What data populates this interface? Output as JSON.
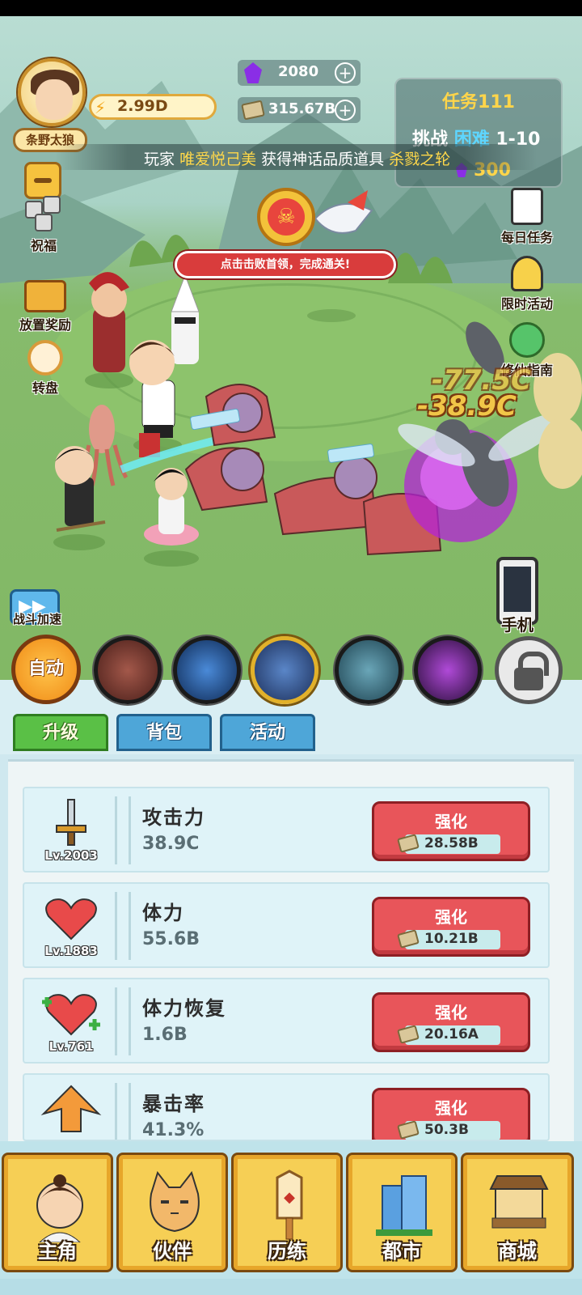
{
  "hud": {
    "player_name": "条野太狼",
    "power": "2.99D",
    "gems": "2080",
    "cash": "315.67B",
    "quest_title": "任务111",
    "quest_challenge_prefix": "挑战",
    "quest_difficulty": "困难",
    "quest_stage": "1-10",
    "quest_reward": "300",
    "ticker": {
      "prefix": "玩家",
      "player": "唯爱悦己美",
      "middle": "获得神话品质道具",
      "item": "杀戮之轮"
    },
    "boss_banner": "点击击败首领，完成通关!"
  },
  "left_menu": [
    {
      "label": "祝福",
      "icon": "dice-icon"
    },
    {
      "label": "放置奖励",
      "icon": "treasure-chest-icon"
    },
    {
      "label": "转盘",
      "icon": "wheel-icon"
    }
  ],
  "right_menu": [
    {
      "label": "每日任务",
      "icon": "daily-task-icon"
    },
    {
      "label": "限时活动",
      "icon": "party-popper-icon"
    },
    {
      "label": "修仙指南",
      "icon": "guide-icon"
    }
  ],
  "damage_numbers": [
    "-77.5C",
    "-38.9C"
  ],
  "battle_speed_label": "战斗加速",
  "phone_label": "手机",
  "auto_label": "自动",
  "skills": [
    "wolf-skill-icon",
    "blue-slash-skill-icon",
    "lightning-gate-skill-icon",
    "dragon-skill-icon",
    "purple-vortex-skill-icon",
    "lock-icon"
  ],
  "tabs": [
    "升级",
    "背包",
    "活动"
  ],
  "upgrades": [
    {
      "name": "攻击力",
      "value": "38.9C",
      "level": "Lv.2003",
      "button": "强化",
      "cost": "28.58B",
      "icon": "sword-icon"
    },
    {
      "name": "体力",
      "value": "55.6B",
      "level": "Lv.1883",
      "button": "强化",
      "cost": "10.21B",
      "icon": "heart-icon"
    },
    {
      "name": "体力恢复",
      "value": "1.6B",
      "level": "Lv.761",
      "button": "强化",
      "cost": "20.16A",
      "icon": "heart-plus-icon"
    },
    {
      "name": "暴击率",
      "value": "41.3%",
      "level": "",
      "button": "强化",
      "cost": "50.3B",
      "icon": "crit-arrow-icon"
    }
  ],
  "nav": [
    {
      "label": "主角",
      "icon": "hero-icon"
    },
    {
      "label": "伙伴",
      "icon": "cat-icon"
    },
    {
      "label": "历练",
      "icon": "trial-sign-icon"
    },
    {
      "label": "都市",
      "icon": "city-icon"
    },
    {
      "label": "商城",
      "icon": "shop-stall-icon"
    }
  ],
  "colors": {
    "accent": "#f6cf55",
    "enhance": "#e8555a",
    "tab_active": "#5ac046",
    "tab_inactive": "#4ea6d8"
  }
}
